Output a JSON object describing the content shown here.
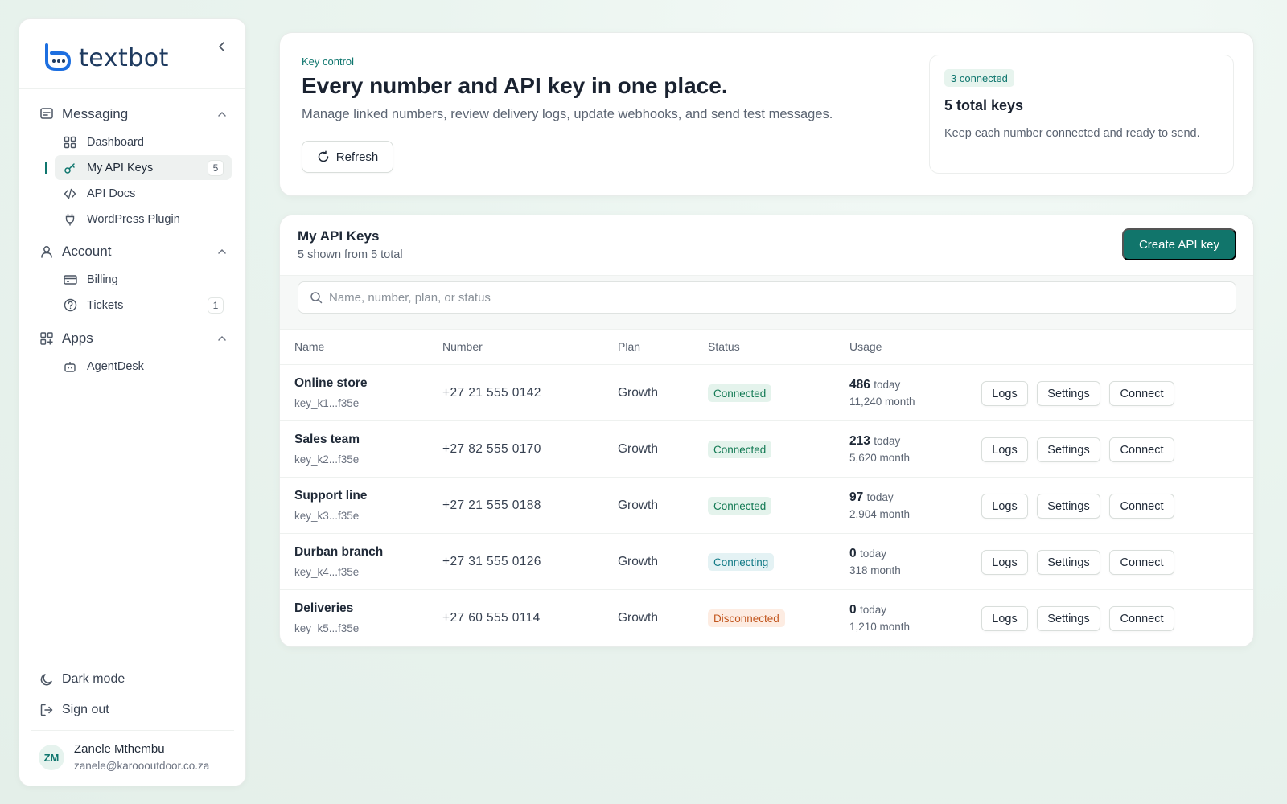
{
  "brand": {
    "name": "textbot",
    "accent": "#0f766e"
  },
  "sidebar": {
    "groups": [
      {
        "label": "Messaging",
        "icon": "message-square-icon",
        "items": [
          {
            "label": "Dashboard",
            "icon": "grid-icon",
            "badge": ""
          },
          {
            "label": "My API Keys",
            "icon": "key-icon",
            "badge": "5",
            "active": true
          },
          {
            "label": "API Docs",
            "icon": "code-icon",
            "badge": ""
          },
          {
            "label": "WordPress Plugin",
            "icon": "plug-icon",
            "badge": ""
          }
        ]
      },
      {
        "label": "Account",
        "icon": "user-icon",
        "items": [
          {
            "label": "Billing",
            "icon": "credit-card-icon",
            "badge": ""
          },
          {
            "label": "Tickets",
            "icon": "help-circle-icon",
            "badge": "1"
          }
        ]
      },
      {
        "label": "Apps",
        "icon": "apps-icon",
        "items": [
          {
            "label": "AgentDesk",
            "icon": "bot-icon",
            "badge": ""
          }
        ]
      }
    ],
    "dark_mode_label": "Dark mode",
    "sign_out_label": "Sign out",
    "user": {
      "initials": "ZM",
      "name": "Zanele Mthembu",
      "email": "zanele@karoooutdoor.co.za"
    }
  },
  "hero": {
    "eyebrow": "Key control",
    "title": "Every number and API key in one place.",
    "subtitle": "Manage linked numbers, review delivery logs, update webhooks, and send test messages.",
    "refresh_label": "Refresh",
    "stat": {
      "pill": "3 connected",
      "title": "5 total keys",
      "desc": "Keep each number connected and ready to send."
    }
  },
  "keys": {
    "title": "My API Keys",
    "subtitle": "5 shown from 5 total",
    "create_label": "Create API key",
    "search_placeholder": "Name, number, plan, or status",
    "columns": [
      "Name",
      "Number",
      "Plan",
      "Status",
      "Usage"
    ],
    "today_suffix": "today",
    "actions": {
      "logs": "Logs",
      "settings": "Settings",
      "connect": "Connect"
    },
    "rows": [
      {
        "name": "Online store",
        "key": "key_k1...f35e",
        "number": "+27 21 555 0142",
        "plan": "Growth",
        "status": "Connected",
        "status_type": "connected",
        "today": "486",
        "month": "11,240 month"
      },
      {
        "name": "Sales team",
        "key": "key_k2...f35e",
        "number": "+27 82 555 0170",
        "plan": "Growth",
        "status": "Connected",
        "status_type": "connected",
        "today": "213",
        "month": "5,620 month"
      },
      {
        "name": "Support line",
        "key": "key_k3...f35e",
        "number": "+27 21 555 0188",
        "plan": "Growth",
        "status": "Connected",
        "status_type": "connected",
        "today": "97",
        "month": "2,904 month"
      },
      {
        "name": "Durban branch",
        "key": "key_k4...f35e",
        "number": "+27 31 555 0126",
        "plan": "Growth",
        "status": "Connecting",
        "status_type": "connecting",
        "today": "0",
        "month": "318 month"
      },
      {
        "name": "Deliveries",
        "key": "key_k5...f35e",
        "number": "+27 60 555 0114",
        "plan": "Growth",
        "status": "Disconnected",
        "status_type": "disconnected",
        "today": "0",
        "month": "1,210 month"
      }
    ]
  }
}
